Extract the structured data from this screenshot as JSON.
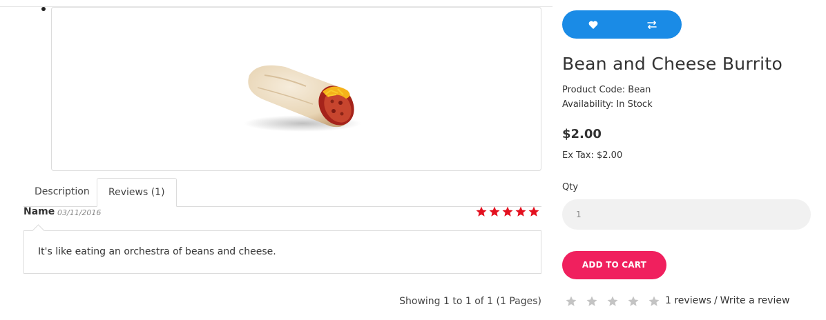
{
  "product": {
    "title": "Bean and Cheese Burrito",
    "code_line": "Product Code: Bean",
    "availability_line": "Availability: In Stock",
    "price": "$2.00",
    "ex_tax": "Ex Tax: $2.00"
  },
  "tabs": [
    {
      "label": "Description"
    },
    {
      "label": "Reviews (1)"
    }
  ],
  "review": {
    "author": "Name",
    "date": "03/11/2016",
    "rating": 5,
    "text": "It's like eating an orchestra of beans and cheese."
  },
  "pagination": "Showing 1 to 1 of 1 (1 Pages)",
  "actions": {
    "wishlist_icon": "heart-icon",
    "compare_icon": "compare-arrows-icon",
    "qty_label": "Qty",
    "qty_value": "1",
    "add_to_cart": "ADD TO CART"
  },
  "rating_summary": {
    "stars": 0,
    "reviews_link": "1 reviews",
    "separator": "/",
    "write_review_link": "Write a review"
  },
  "colors": {
    "primary_blue": "#1a8be6",
    "cart_pink": "#f0205e",
    "review_star_red": "#e3101f",
    "empty_star_gray": "#c4c4c4"
  }
}
